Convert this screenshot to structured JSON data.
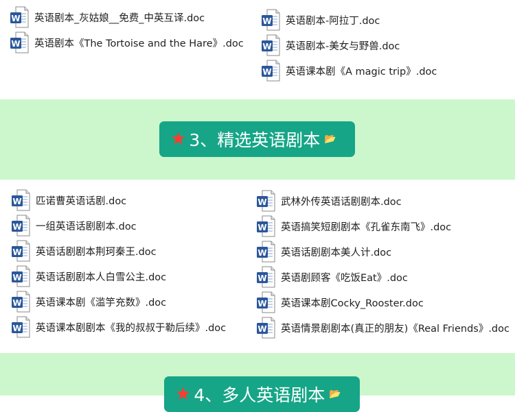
{
  "section_top": {
    "left_files": [
      "英语剧本_灰姑娘__免费_中英互译.doc",
      "英语剧本《The Tortoise and the Hare》.doc"
    ],
    "right_files": [
      "英语剧本-阿拉丁.doc",
      "英语剧本-美女与野兽.doc",
      "英语课本剧《A magic trip》.doc"
    ]
  },
  "section3": {
    "title": "3、精选英语剧本",
    "left_files": [
      "匹诺曹英语话剧.doc",
      "一组英语话剧剧本.doc",
      "英语话剧剧本荆珂秦王.doc",
      "英语话剧剧本人白雪公主.doc",
      "英语课本剧《滥竽充数》.doc",
      "英语课本剧剧本《我的叔叔于勒后续》.doc"
    ],
    "right_files": [
      "武林外传英语话剧剧本.doc",
      "英语搞笑短剧剧本《孔雀东南飞》.doc",
      "英语话剧剧本美人计.doc",
      "英语剧顾客《吃饭Eat》.doc",
      "英语课本剧Cocky_Rooster.doc",
      "英语情景剧剧本(真正的朋友)《Real Friends》.doc"
    ]
  },
  "section4": {
    "title": "4、多人英语剧本"
  },
  "icons": {
    "file": "word-doc-icon",
    "star": "star-icon",
    "folder": "folder-icon"
  },
  "colors": {
    "band": "#ccf7cc",
    "pill": "#16a587",
    "star": "#ff3b30",
    "word_blue": "#2b579a"
  }
}
